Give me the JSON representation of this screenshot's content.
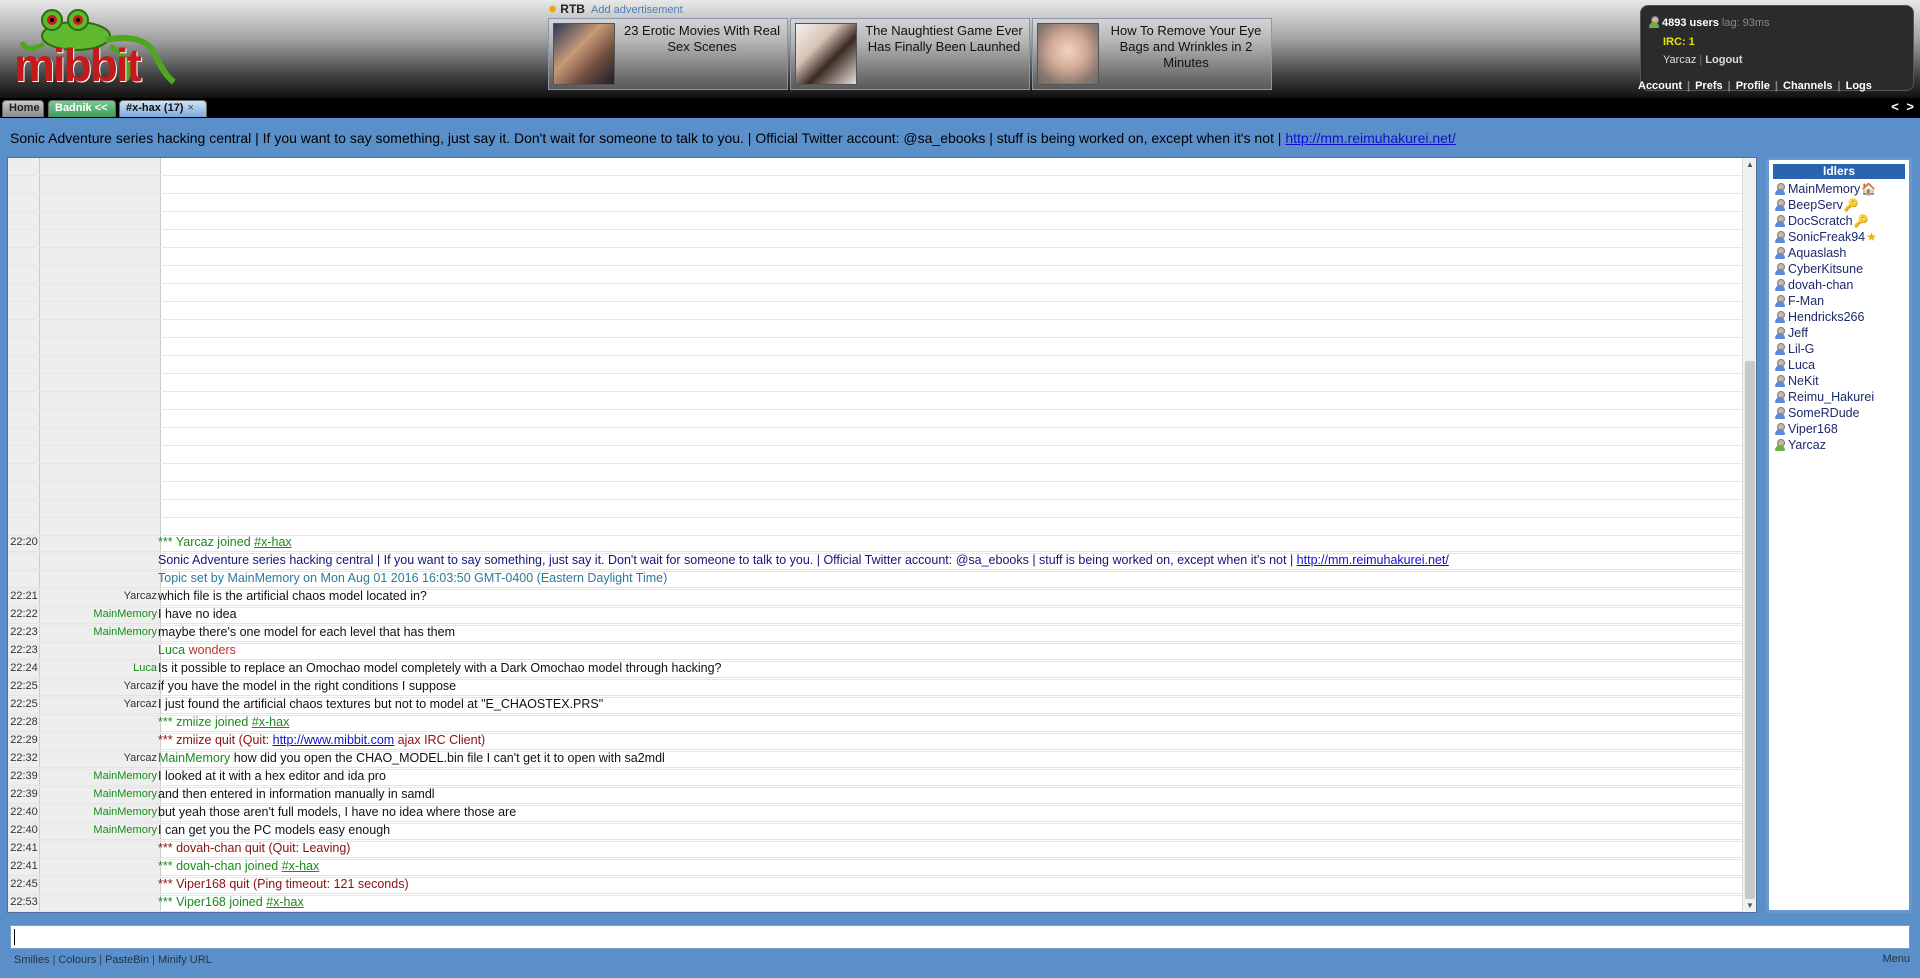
{
  "colors": {
    "background": "#5b8fca",
    "join": "#1a8a1a",
    "quit": "#8a1010",
    "link": "#1010cc"
  },
  "header": {
    "logo_text": "mibbit",
    "ads": {
      "brand": "RTB",
      "add_label": "Add advertisement",
      "items": [
        {
          "title": "23 Erotic Movies With Real Sex Scenes"
        },
        {
          "title": "The Naughtiest Game Ever Has Finally Been Launhed"
        },
        {
          "title": "How To Remove Your Eye Bags and Wrinkles in 2 Minutes"
        }
      ]
    },
    "status": {
      "users": "4893 users",
      "lag": "lag: 93ms",
      "irc": "IRC: 1",
      "nick": "Yarcaz",
      "logout": "Logout"
    },
    "links": [
      "Account",
      "Prefs",
      "Profile",
      "Channels",
      "Logs"
    ]
  },
  "tabs": {
    "home": "Home",
    "badnik": "Badnik <<",
    "channel": "#x-hax (17)",
    "close": "×",
    "arrows": "< >"
  },
  "topic": {
    "text": "Sonic Adventure series hacking central | If you want to say something, just say it. Don't wait for someone to talk to you. | Official Twitter account: @sa_ebooks | stuff is being worked on, except when it's not | ",
    "url": "http://mm.reimuhakurei.net/"
  },
  "messages": [
    {
      "time": "22:20",
      "nick": "",
      "pre": "*** Yarcaz joined ",
      "link": "#x-hax",
      "post": ""
    },
    {
      "time": "",
      "nick": "",
      "text": "Sonic Adventure series hacking central | If you want to say something, just say it. Don't wait for someone to talk to you. | Official Twitter account: @sa_ebooks | stuff is being worked on, except when it's not | ",
      "link": "http://mm.reimuhakurei.net/"
    },
    {
      "time": "",
      "nick": "",
      "text": "Topic set by MainMemory on Mon Aug 01 2016 16:03:50 GMT-0400 (Eastern Daylight Time)"
    },
    {
      "time": "22:21",
      "nick": "Yarcaz",
      "text": "which file is the artificial chaos model located in?"
    },
    {
      "time": "22:22",
      "nick": "MainMemory",
      "text": "I have no idea"
    },
    {
      "time": "22:23",
      "nick": "MainMemory",
      "text": "maybe there's one model for each level that has them"
    },
    {
      "time": "22:23",
      "nick": "",
      "actor": "Luca",
      "text": "wonders"
    },
    {
      "time": "22:24",
      "nick": "Luca",
      "text": "Is it possible to replace an Omochao model completely with a Dark Omochao model through hacking?"
    },
    {
      "time": "22:25",
      "nick": "Yarcaz",
      "text": "if you have the model in the right conditions I suppose"
    },
    {
      "time": "22:25",
      "nick": "Yarcaz",
      "text": "I just found the artificial chaos textures but not to model at \"E_CHAOSTEX.PRS\""
    },
    {
      "time": "22:28",
      "nick": "",
      "pre": "*** zmiize joined ",
      "link": "#x-hax",
      "post": ""
    },
    {
      "time": "22:29",
      "nick": "",
      "pre": "*** zmiize quit (Quit: ",
      "link": "http://www.mibbit.com",
      "post": " ajax IRC Client)"
    },
    {
      "time": "22:32",
      "nick": "Yarcaz",
      "mention": "MainMemory",
      "text": "how did you open the CHAO_MODEL.bin file I can't get it to open with sa2mdl"
    },
    {
      "time": "22:39",
      "nick": "MainMemory",
      "text": "I looked at it with a hex editor and ida pro"
    },
    {
      "time": "22:39",
      "nick": "MainMemory",
      "text": "and then entered in information manually in samdl"
    },
    {
      "time": "22:40",
      "nick": "MainMemory",
      "text": "but yeah those aren't full models, I have no idea where those are"
    },
    {
      "time": "22:40",
      "nick": "MainMemory",
      "text": "I can get you the PC models easy enough"
    },
    {
      "time": "22:41",
      "nick": "",
      "text": "*** dovah-chan quit (Quit: Leaving)"
    },
    {
      "time": "22:41",
      "nick": "",
      "pre": "*** dovah-chan joined ",
      "link": "#x-hax",
      "post": ""
    },
    {
      "time": "22:45",
      "nick": "",
      "text": "*** Viper168 quit (Ping timeout: 121 seconds)"
    },
    {
      "time": "22:53",
      "nick": "",
      "pre": "*** Viper168 joined ",
      "link": "#x-hax",
      "post": ""
    }
  ],
  "userlist": {
    "title": "Idlers",
    "users": [
      {
        "name": "MainMemory",
        "badge": "home-icon",
        "glyph": "🏠"
      },
      {
        "name": "BeepServ",
        "badge": "key-icon",
        "glyph": "🔑"
      },
      {
        "name": "DocScratch",
        "badge": "key-icon",
        "glyph": "🔑"
      },
      {
        "name": "SonicFreak94",
        "badge": "star-icon",
        "glyph": "★"
      },
      {
        "name": "Aquaslash"
      },
      {
        "name": "CyberKitsune"
      },
      {
        "name": "dovah-chan"
      },
      {
        "name": "F-Man"
      },
      {
        "name": "Hendricks266"
      },
      {
        "name": "Jeff"
      },
      {
        "name": "Lil-G"
      },
      {
        "name": "Luca"
      },
      {
        "name": "NeKit"
      },
      {
        "name": "Reimu_Hakurei"
      },
      {
        "name": "SomeRDude"
      },
      {
        "name": "Viper168"
      },
      {
        "name": "Yarcaz",
        "self": true
      }
    ]
  },
  "footer": {
    "links": [
      "Smilies",
      "Colours",
      "PasteBin",
      "Minify URL"
    ],
    "menu": "Menu"
  }
}
